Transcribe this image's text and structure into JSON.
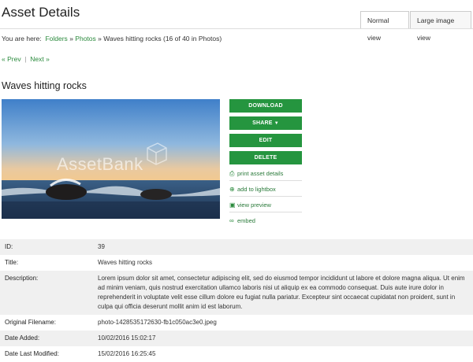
{
  "header": {
    "title": "Asset Details"
  },
  "tabs": [
    {
      "label": "Normal view",
      "active": true
    },
    {
      "label": "Large image view",
      "active": false
    }
  ],
  "breadcrumb": {
    "prefix": "You are here:",
    "folders": "Folders",
    "sep1": "»",
    "photos": "Photos",
    "sep2": "»",
    "current": "Waves hitting rocks (16 of 40 in Photos)"
  },
  "nav": {
    "prev": "« Prev",
    "separator": "|",
    "next": "Next »"
  },
  "asset": {
    "title": "Waves hitting rocks",
    "watermark": "AssetBank"
  },
  "actions": {
    "download": "DOWNLOAD",
    "share": "SHARE",
    "edit": "EDIT",
    "delete": "DELETE",
    "links": [
      {
        "label": "print asset details",
        "icon": "printer-icon"
      },
      {
        "label": "add to lightbox",
        "icon": "plus-circle-icon"
      },
      {
        "label": "view preview",
        "icon": "image-icon"
      },
      {
        "label": "embed",
        "icon": "link-icon"
      }
    ]
  },
  "details": [
    {
      "label": "ID:",
      "value": "39"
    },
    {
      "label": "Title:",
      "value": "Waves hitting rocks"
    },
    {
      "label": "Description:",
      "value": "Lorem ipsum dolor sit amet, consectetur adipiscing elit, sed do eiusmod tempor incididunt ut labore et dolore magna aliqua. Ut enim ad minim veniam, quis nostrud exercitation ullamco laboris nisi ut aliquip ex ea commodo consequat. Duis aute irure dolor in reprehenderit in voluptate velit esse cillum dolore eu fugiat nulla pariatur. Excepteur sint occaecat cupidatat non proident, sunt in culpa qui officia deserunt mollit anim id est laborum."
    },
    {
      "label": "Original Filename:",
      "value": "photo-1428535172630-fb1c050ac3e0.jpeg"
    },
    {
      "label": "Date Added:",
      "value": "10/02/2016 15:02:17"
    },
    {
      "label": "Date Last Modified:",
      "value": "15/02/2016 16:25:45"
    }
  ],
  "colors": {
    "accent": "#25953f",
    "link": "#2a8a3c",
    "row_shade": "#f0f0f0"
  }
}
